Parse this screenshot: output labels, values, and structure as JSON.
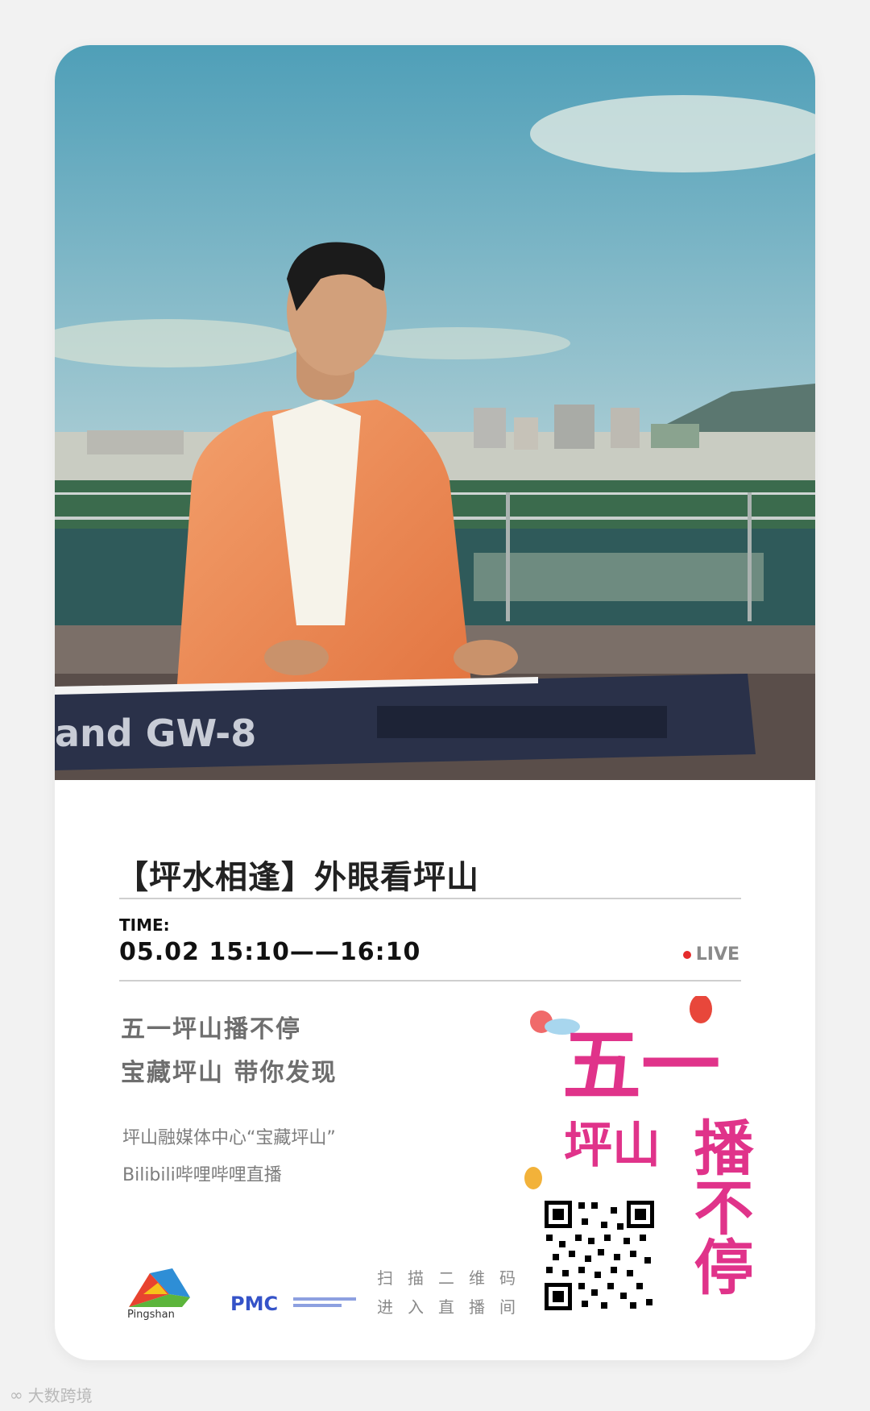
{
  "title": "【坪水相逢】外眼看坪山",
  "time_label": "TIME:",
  "time_value": "05.02  15:10——16:10",
  "live_label": "LIVE",
  "slogan_line1": "五一坪山播不停",
  "slogan_line2": "宝藏坪山 带你发现",
  "info_line1": "坪山融媒体中心“宝藏坪山”",
  "info_line2": "Bilibili哔哩哔哩直播",
  "scan_line1": "扫描二维码",
  "scan_line2": "进入直播间",
  "pingshan_logo_text": "Pingshan",
  "pmc_logo_text": "PMC",
  "poster_text_main": "五一",
  "poster_text_sub": "坪山",
  "poster_text_side": "播不停",
  "keyboard_brand": "and  GW-8",
  "watermark": "大数跨境",
  "colors": {
    "accent_pink": "#e0338a",
    "live_red": "#e52b2b",
    "jacket_orange": "#f08a52"
  }
}
